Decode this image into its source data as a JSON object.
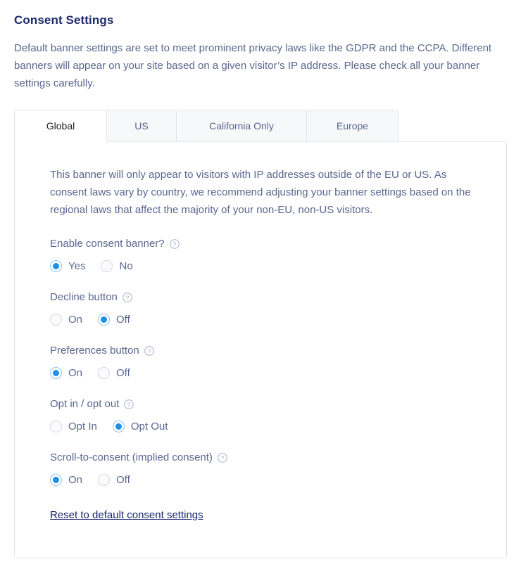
{
  "header": {
    "title": "Consent Settings",
    "description": "Default banner settings are set to meet prominent privacy laws like the GDPR and the CCPA. Different banners will appear on your site based on a given visitor’s IP address. Please check all your banner settings carefully."
  },
  "tabs": [
    {
      "label": "Global",
      "active": true
    },
    {
      "label": "US",
      "active": false
    },
    {
      "label": "California Only",
      "active": false
    },
    {
      "label": "Europe",
      "active": false
    }
  ],
  "panel": {
    "intro": "This banner will only appear to visitors with IP addresses outside of the EU or US. As consent laws vary by country, we recommend adjusting your banner settings based on the regional laws that affect the majority of your non-EU, non-US visitors.",
    "fields": [
      {
        "label": "Enable consent banner?",
        "help_icon": "question-circle-icon",
        "options": [
          {
            "label": "Yes",
            "selected": true
          },
          {
            "label": "No",
            "selected": false
          }
        ]
      },
      {
        "label": "Decline button",
        "help_icon": "question-circle-icon",
        "options": [
          {
            "label": "On",
            "selected": false
          },
          {
            "label": "Off",
            "selected": true
          }
        ]
      },
      {
        "label": "Preferences button",
        "help_icon": "question-circle-icon",
        "options": [
          {
            "label": "On",
            "selected": true
          },
          {
            "label": "Off",
            "selected": false
          }
        ]
      },
      {
        "label": "Opt in / opt out",
        "help_icon": "question-circle-icon",
        "options": [
          {
            "label": "Opt In",
            "selected": false
          },
          {
            "label": "Opt Out",
            "selected": true
          }
        ]
      },
      {
        "label": "Scroll-to-consent (implied consent)",
        "help_icon": "question-circle-icon",
        "options": [
          {
            "label": "On",
            "selected": true
          },
          {
            "label": "Off",
            "selected": false
          }
        ]
      }
    ],
    "reset_link": "Reset to default consent settings"
  },
  "colors": {
    "title": "#1c2a6b",
    "body_text": "#5a668f",
    "radio_accent": "#1e90e8",
    "link": "#17256b",
    "border": "#e3e5ec",
    "tab_inactive_bg": "#f7f8fa"
  }
}
